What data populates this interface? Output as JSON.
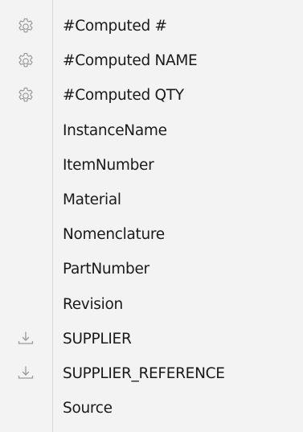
{
  "properties": [
    {
      "label": "#Computed #",
      "icon": "gear-icon"
    },
    {
      "label": "#Computed NAME",
      "icon": "gear-icon"
    },
    {
      "label": "#Computed QTY",
      "icon": "gear-icon"
    },
    {
      "label": "InstanceName",
      "icon": ""
    },
    {
      "label": "ItemNumber",
      "icon": ""
    },
    {
      "label": "Material",
      "icon": ""
    },
    {
      "label": "Nomenclature",
      "icon": ""
    },
    {
      "label": "PartNumber",
      "icon": ""
    },
    {
      "label": "Revision",
      "icon": ""
    },
    {
      "label": "SUPPLIER",
      "icon": "import-icon"
    },
    {
      "label": "SUPPLIER_REFERENCE",
      "icon": "import-icon"
    },
    {
      "label": "Source",
      "icon": ""
    }
  ],
  "colors": {
    "background": "#f3f3f3",
    "text": "#1a1a1a",
    "icon": "#9a9a9a",
    "divider": "#d9d9d9"
  }
}
